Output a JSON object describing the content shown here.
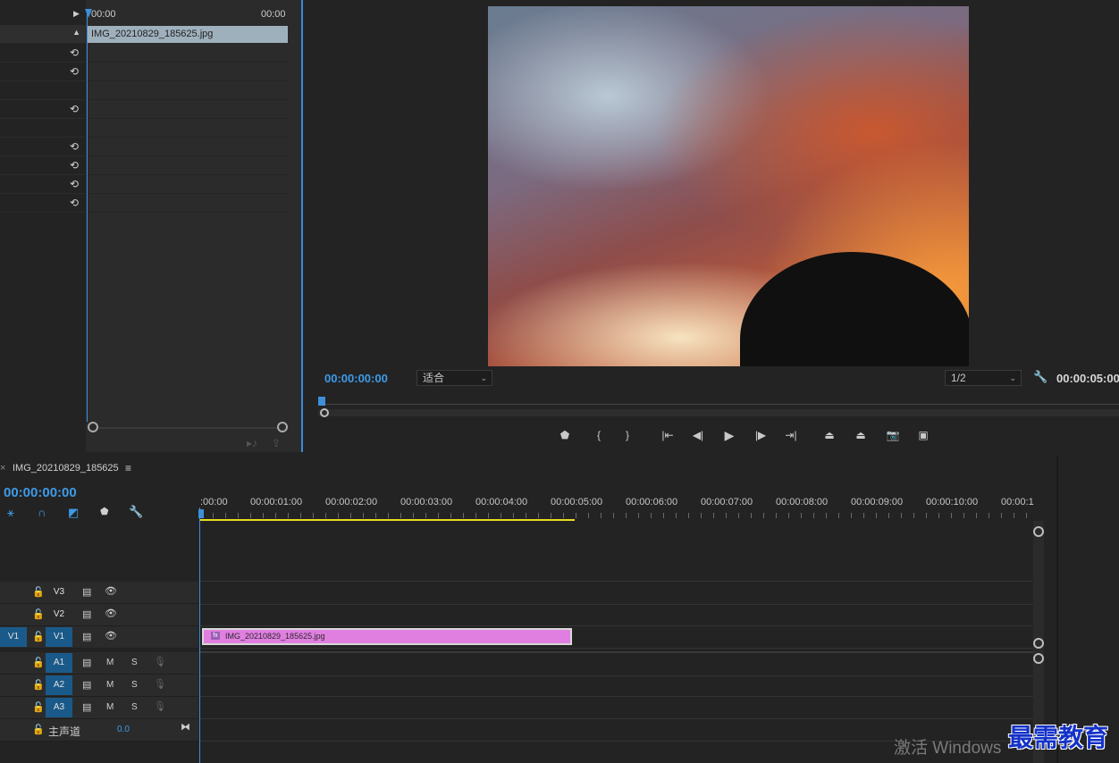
{
  "effect_controls": {
    "time_start": "00:00",
    "time_end": "00:00",
    "clip_name": "IMG_20210829_185625.jpg",
    "reset_icon": "reset-icon"
  },
  "program_monitor": {
    "timecode": "00:00:00:00",
    "zoom": "适合",
    "resolution": "1/2",
    "duration": "00:00:05:00",
    "image": "sunset-sky-photo"
  },
  "timeline": {
    "sequence_name": "IMG_20210829_185625",
    "timecode": "00:00:00:00",
    "ruler": ":00:00|00:00:01:00|00:00:02:00|00:00:03:00|00:00:04:00|00:00:05:00|00:00:06:00|00:00:07:00|00:00:08:00|00:00:09:00|00:00:10:00|00:00:1",
    "ruler_labels": [
      ":00:00",
      "00:00:01:00",
      "00:00:02:00",
      "00:00:03:00",
      "00:00:04:00",
      "00:00:05:00",
      "00:00:06:00",
      "00:00:07:00",
      "00:00:08:00",
      "00:00:09:00",
      "00:00:10:00",
      "00:00:1"
    ],
    "video_tracks": [
      {
        "name": "V3",
        "source": ""
      },
      {
        "name": "V2",
        "source": ""
      },
      {
        "name": "V1",
        "source": "V1"
      }
    ],
    "audio_tracks": [
      {
        "name": "A1",
        "mute": "M",
        "solo": "S"
      },
      {
        "name": "A2",
        "mute": "M",
        "solo": "S"
      },
      {
        "name": "A3",
        "mute": "M",
        "solo": "S"
      }
    ],
    "master_label": "主声道",
    "master_value": "0.0",
    "clip_name": "IMG_20210829_185625.jpg",
    "clip_color": "#e07fe0"
  },
  "watermarks": {
    "activate": "激活 Windows",
    "brand": "最需教育"
  }
}
